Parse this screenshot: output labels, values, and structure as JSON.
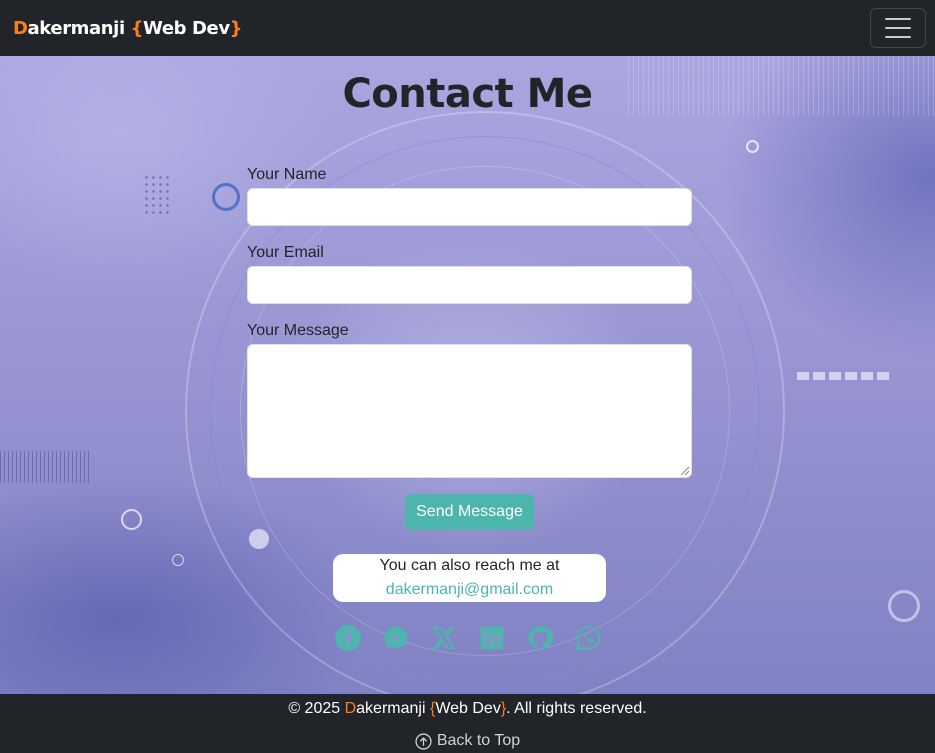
{
  "navbar": {
    "brand_first_letter": "D",
    "brand_rest": "akermanji ",
    "brand_open_brace": "{",
    "brand_web_dev": "Web Dev",
    "brand_close_brace": "}",
    "menu_icon": "hamburger-icon"
  },
  "contact": {
    "title": "Contact Me",
    "name_label": "Your Name",
    "email_label": "Your Email",
    "message_label": "Your Message",
    "send_button": "Send Message",
    "reach_text": "You can also reach me at",
    "reach_email": "dakermanji@gmail.com"
  },
  "socials": [
    {
      "icon": "facebook-icon"
    },
    {
      "icon": "messenger-icon"
    },
    {
      "icon": "x-twitter-icon"
    },
    {
      "icon": "linkedin-icon"
    },
    {
      "icon": "github-icon"
    },
    {
      "icon": "whatsapp-icon"
    }
  ],
  "footer": {
    "copyright_prefix": "© 2025 ",
    "brand_first_letter": "D",
    "brand_rest": "akermanji ",
    "open_brace": "{",
    "web_dev": "Web Dev",
    "close_brace": "}",
    "suffix": ". All rights reserved.",
    "back_to_top": "Back to Top",
    "back_to_top_icon": "arrow-up-circle-icon"
  },
  "colors": {
    "navbar_bg": "#212529",
    "accent_orange": "#fd7e14",
    "teal": "#4db6ac",
    "background_purple": "#9a96d3"
  }
}
